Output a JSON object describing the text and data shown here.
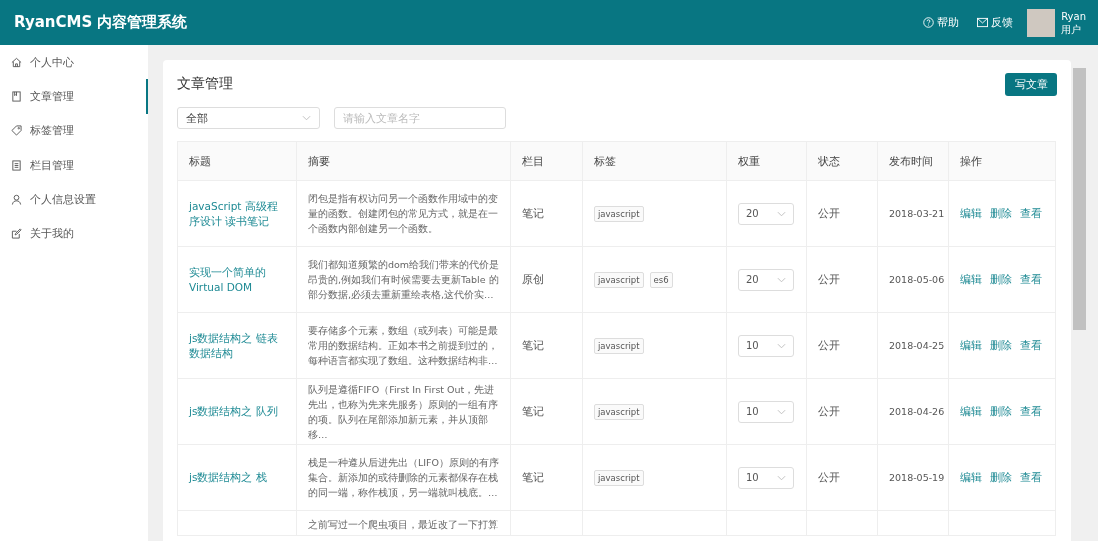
{
  "header": {
    "title": "RyanCMS 内容管理系统",
    "links": [
      {
        "kind": "help",
        "label": "帮助"
      },
      {
        "kind": "feedback",
        "label": "反馈"
      }
    ],
    "user": {
      "name": "Ryan",
      "role": "用户"
    }
  },
  "sidebar": {
    "items": [
      {
        "kind": "home",
        "label": "个人中心",
        "selected": false
      },
      {
        "kind": "doc",
        "label": "文章管理",
        "selected": true
      },
      {
        "kind": "tag",
        "label": "标签管理",
        "selected": false
      },
      {
        "kind": "list",
        "label": "栏目管理",
        "selected": false
      },
      {
        "kind": "user",
        "label": "个人信息设置",
        "selected": false
      },
      {
        "kind": "edit",
        "label": "关于我的",
        "selected": false
      }
    ]
  },
  "panel": {
    "title": "文章管理",
    "new_button": "写文章",
    "filter": {
      "value": "全部"
    },
    "search": {
      "placeholder": "请输入文章名字"
    }
  },
  "table": {
    "columns": [
      "标题",
      "摘要",
      "栏目",
      "标签",
      "权重",
      "状态",
      "发布时间",
      "操作"
    ],
    "rows": [
      {
        "title": "javaScript 高级程序设计 读书笔记",
        "summary": "闭包是指有权访问另一个函数作用域中的变量的函数。创建闭包的常见方式，就是在一个函数内部创建另一个函数。",
        "category": "笔记",
        "tags": [
          "javascript"
        ],
        "weight": "20",
        "status": "公开",
        "date": "2018-03-21",
        "actions": [
          "编辑",
          "删除",
          "查看"
        ]
      },
      {
        "title": "实现一个简单的 Virtual DOM",
        "summary": "我们都知道频繁的dom给我们带来的代价是昂贵的,例如我们有时候需要去更新Table 的部分数据,必须去重新重绘表格,这代价实…",
        "category": "原创",
        "tags": [
          "javascript",
          "es6"
        ],
        "weight": "20",
        "status": "公开",
        "date": "2018-05-06",
        "actions": [
          "编辑",
          "删除",
          "查看"
        ]
      },
      {
        "title": "js数据结构之 链表数据结构",
        "summary": "要存储多个元素，数组（或列表）可能是最常用的数据结构。正如本书之前提到过的，每种语言都实现了数组。这种数据结构非…",
        "category": "笔记",
        "tags": [
          "javascript"
        ],
        "weight": "10",
        "status": "公开",
        "date": "2018-04-25",
        "actions": [
          "编辑",
          "删除",
          "查看"
        ]
      },
      {
        "title": "js数据结构之 队列",
        "summary": "队列是遵循FIFO（First In First Out，先进先出，也称为先来先服务）原则的一组有序的项。队列在尾部添加新元素，并从顶部移…",
        "category": "笔记",
        "tags": [
          "javascript"
        ],
        "weight": "10",
        "status": "公开",
        "date": "2018-04-26",
        "actions": [
          "编辑",
          "删除",
          "查看"
        ]
      },
      {
        "title": "js数据结构之 栈",
        "summary": "栈是一种遵从后进先出（LIFO）原则的有序集合。新添加的或待删除的元素都保存在栈的同一端，称作栈顶，另一端就叫栈底。…",
        "category": "笔记",
        "tags": [
          "javascript"
        ],
        "weight": "10",
        "status": "公开",
        "date": "2018-05-19",
        "actions": [
          "编辑",
          "删除",
          "查看"
        ]
      },
      {
        "summary": "之前写过一个爬虫项目，最近改了一下打算"
      }
    ]
  }
}
